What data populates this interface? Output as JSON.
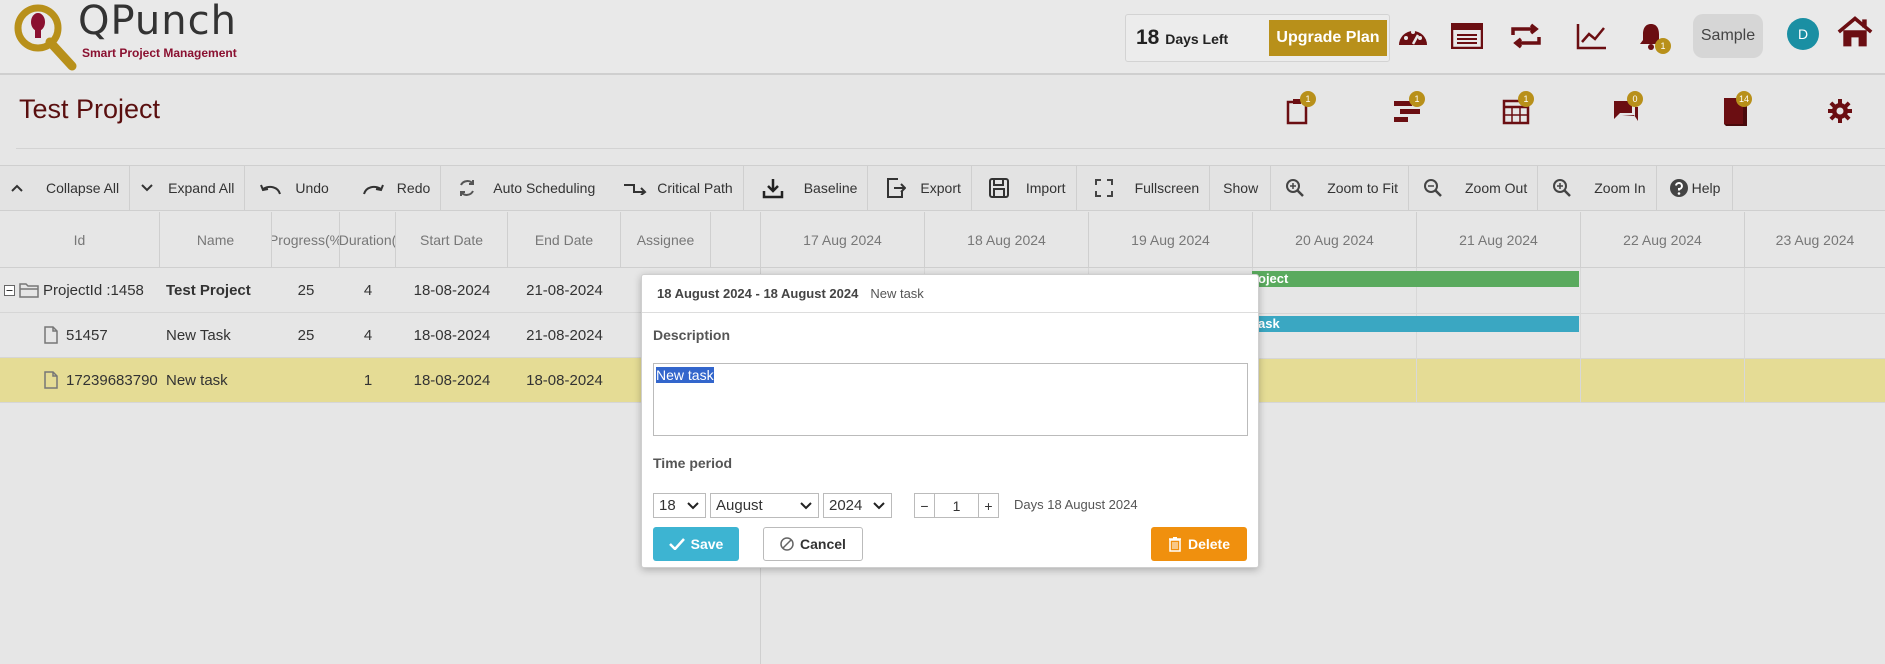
{
  "app": {
    "logo_name": "QPunch",
    "logo_tagline": "Smart Project Management",
    "trial_days": "18",
    "trial_unit": "Days Left",
    "upgrade_label": "Upgrade Plan",
    "notification_count": "1",
    "user_label": "Sample",
    "avatar_initial": "D"
  },
  "project": {
    "title": "Test Project",
    "icon_badges": [
      "1",
      "1",
      "1",
      "0",
      "14"
    ]
  },
  "toolbar": {
    "collapse_all": "Collapse All",
    "expand_all": "Expand All",
    "undo": "Undo",
    "redo": "Redo",
    "auto_scheduling": "Auto Scheduling",
    "critical_path": "Critical Path",
    "baseline": "Baseline",
    "export": "Export",
    "import": "Import",
    "fullscreen": "Fullscreen",
    "show": "Show",
    "zoom_fit": "Zoom to Fit",
    "zoom_out": "Zoom Out",
    "zoom_in": "Zoom In",
    "help": "Help"
  },
  "grid": {
    "columns": [
      "Id",
      "Name",
      "Progress(%",
      "Duration(",
      "Start Date",
      "End Date",
      "Assignee"
    ],
    "rows": [
      {
        "id": "ProjectId :1458",
        "name": "Test Project",
        "progress": "25",
        "duration": "4",
        "start": "18-08-2024",
        "end": "21-08-2024"
      },
      {
        "id": "51457",
        "name": "New Task",
        "progress": "25",
        "duration": "4",
        "start": "18-08-2024",
        "end": "21-08-2024"
      },
      {
        "id": "17239683790",
        "name": "New task",
        "progress": "",
        "duration": "1",
        "start": "18-08-2024",
        "end": "18-08-2024"
      }
    ]
  },
  "gantt": {
    "days": [
      "17 Aug 2024",
      "18 Aug 2024",
      "19 Aug 2024",
      "20 Aug 2024",
      "21 Aug 2024",
      "22 Aug 2024",
      "23 Aug 2024"
    ],
    "bar_project_label": "oject",
    "bar_task_label": "ask",
    "colors": {
      "project": "#5aaa5e",
      "task": "#3aa7c2",
      "selected_row": "#e5dc95"
    }
  },
  "modal": {
    "date_range": "18 August 2024 - 18 August 2024",
    "task_name": "New task",
    "description_label": "Description",
    "description_value": "New task",
    "time_period_label": "Time period",
    "day": "18",
    "month": "August",
    "year": "2024",
    "decrement": "−",
    "duration": "1",
    "increment": "+",
    "days_text": "Days 18 August 2024",
    "save_label": "Save",
    "cancel_label": "Cancel",
    "delete_label": "Delete"
  }
}
